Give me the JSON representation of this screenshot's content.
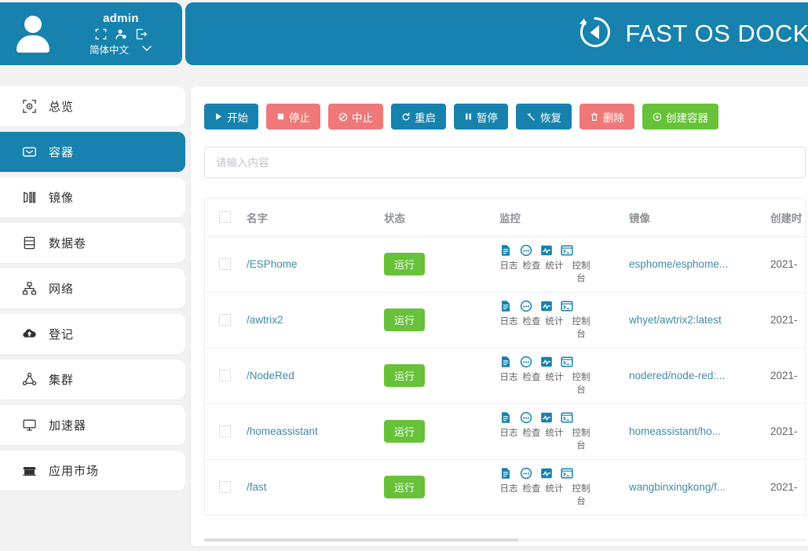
{
  "header": {
    "user_name": "admin",
    "icons": [
      "fullscreen-icon",
      "user-settings-icon",
      "logout-icon"
    ],
    "language_label": "简体中文",
    "language_caret": "chevron-down-icon",
    "brand_title": "FAST OS DOCKER",
    "brand_logo": "fastos-logo-icon",
    "brand_color": "#1682ad"
  },
  "sidebar": {
    "items": [
      {
        "label": "总览",
        "icon": "overview-icon",
        "active": false
      },
      {
        "label": "容器",
        "icon": "container-icon",
        "active": true
      },
      {
        "label": "镜像",
        "icon": "image-icon",
        "active": false
      },
      {
        "label": "数据卷",
        "icon": "volume-icon",
        "active": false
      },
      {
        "label": "网络",
        "icon": "network-icon",
        "active": false
      },
      {
        "label": "登记",
        "icon": "registry-cloud-icon",
        "active": false
      },
      {
        "label": "集群",
        "icon": "cluster-icon",
        "active": false
      },
      {
        "label": "加速器",
        "icon": "accelerator-monitor-icon",
        "active": false
      },
      {
        "label": "应用市场",
        "icon": "app-market-icon",
        "active": false
      }
    ]
  },
  "toolbar": {
    "buttons": [
      {
        "label": "开始",
        "icon": "play-icon",
        "style": "blue"
      },
      {
        "label": "停止",
        "icon": "stop-square-icon",
        "style": "red"
      },
      {
        "label": "中止",
        "icon": "ban-icon",
        "style": "red"
      },
      {
        "label": "重启",
        "icon": "restart-icon",
        "style": "blue"
      },
      {
        "label": "暂停",
        "icon": "pause-icon",
        "style": "blue"
      },
      {
        "label": "恢复",
        "icon": "resume-arrow-icon",
        "style": "blue"
      },
      {
        "label": "删除",
        "icon": "trash-icon",
        "style": "red"
      },
      {
        "label": "创建容器",
        "icon": "plus-circle-icon",
        "style": "green"
      }
    ]
  },
  "search": {
    "value": "",
    "placeholder": "请输入内容"
  },
  "table": {
    "columns": [
      "名字",
      "状态",
      "监控",
      "镜像",
      "创建时"
    ],
    "monitor_actions": [
      {
        "label": "日志",
        "icon": "log-document-icon"
      },
      {
        "label": "检查",
        "icon": "inspect-dots-icon"
      },
      {
        "label": "统计",
        "icon": "stats-chart-icon"
      },
      {
        "label": "控制台",
        "icon": "console-terminal-icon"
      }
    ],
    "rows": [
      {
        "name": "/ESPhome",
        "state": "运行",
        "image": "esphome/esphome...",
        "created": "2021-"
      },
      {
        "name": "/awtrix2",
        "state": "运行",
        "image": "whyet/awtrix2:latest",
        "created": "2021-"
      },
      {
        "name": "/NodeRed",
        "state": "运行",
        "image": "nodered/node-red:...",
        "created": "2021-"
      },
      {
        "name": "/homeassistant",
        "state": "运行",
        "image": "homeassistant/ho...",
        "created": "2021-"
      },
      {
        "name": "/fast",
        "state": "运行",
        "image": "wangbinxingkong/f...",
        "created": "2021-"
      }
    ]
  },
  "colors": {
    "brand_blue": "#1682ad",
    "danger_red": "#f07878",
    "success_green": "#67c23a",
    "link_teal": "#3f8ca6",
    "page_bg": "#f2f2f2"
  }
}
